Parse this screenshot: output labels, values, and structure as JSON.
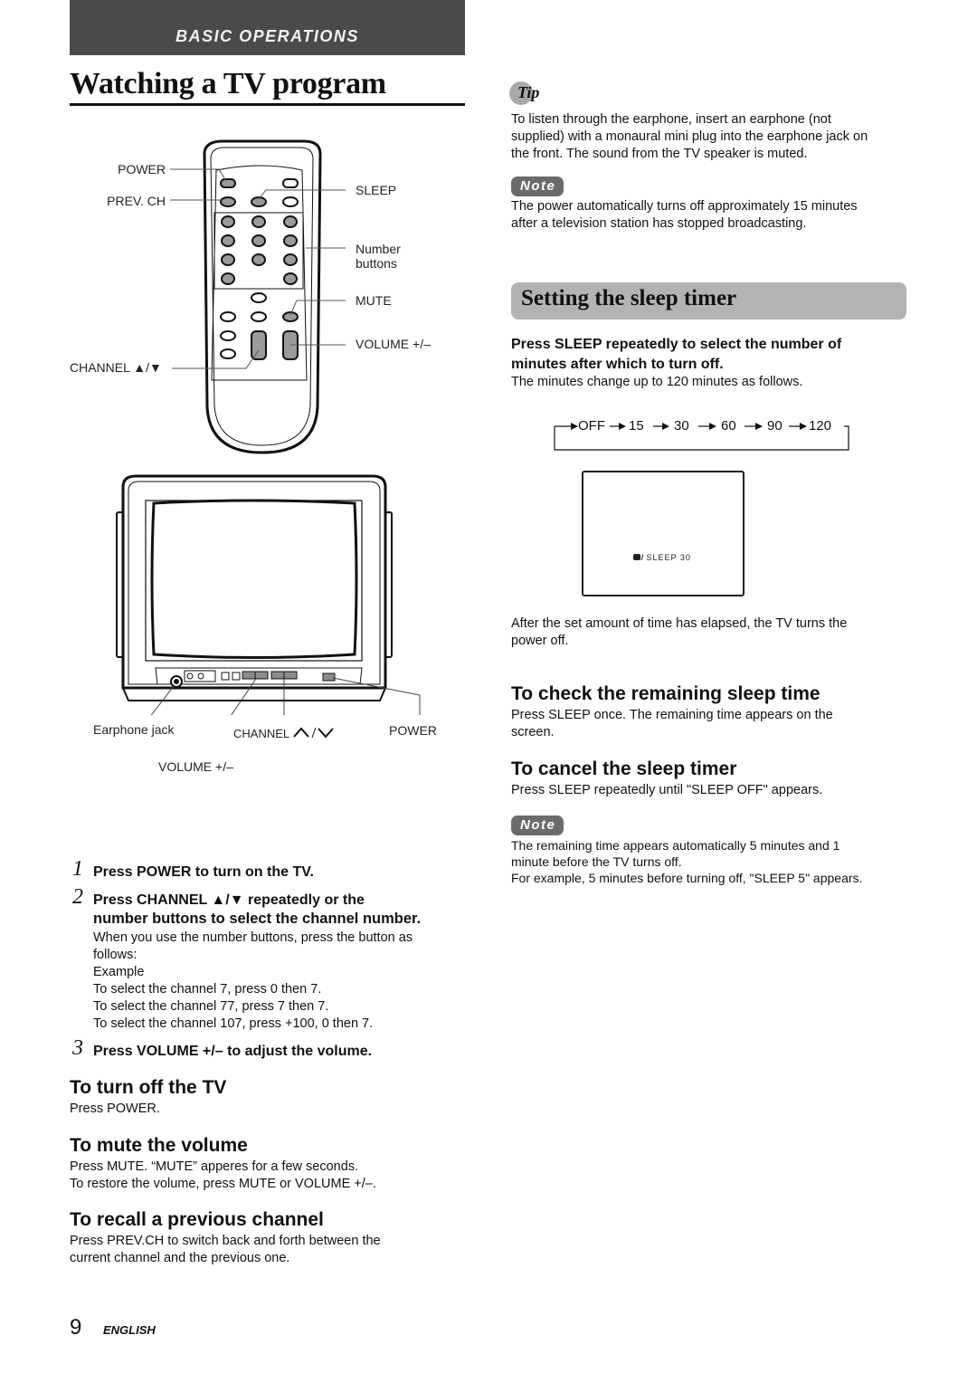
{
  "header": {
    "section": "BASIC OPERATIONS",
    "title": "Watching a TV program"
  },
  "remote_labels": {
    "power": "POWER",
    "prev_ch": "PREV. CH",
    "sleep": "SLEEP",
    "number_buttons_1": "Number",
    "number_buttons_2": "buttons",
    "mute": "MUTE",
    "volume": "VOLUME +/–",
    "channel": "CHANNEL ▲/▼"
  },
  "tv_labels": {
    "earphone": "Earphone jack",
    "channel": "CHANNEL",
    "power": "POWER",
    "volume": "VOLUME +/–"
  },
  "steps": [
    {
      "num": "1",
      "title": "Press POWER to turn on the TV."
    },
    {
      "num": "2",
      "title_1": "Press CHANNEL ▲/▼ repeatedly or the",
      "title_2": "number buttons to select the channel number.",
      "lines": [
        "When you use the number buttons, press the button as",
        "follows:",
        "Example",
        "To select the channel 7, press 0 then 7.",
        "To select the channel 77, press 7 then 7.",
        "To select the channel 107, press +100, 0 then 7."
      ]
    },
    {
      "num": "3",
      "title": "Press VOLUME +/– to adjust the volume."
    }
  ],
  "left_sections": [
    {
      "heading": "To turn off the TV",
      "lines": [
        "Press POWER."
      ]
    },
    {
      "heading": "To mute the volume",
      "lines": [
        "Press MUTE.  “MUTE” apperes for a few seconds.",
        "To restore the volume, press MUTE or VOLUME +/–."
      ]
    },
    {
      "heading": "To recall a previous channel",
      "lines": [
        "Press PREV.CH to switch back and forth between the",
        "current channel and the previous one."
      ]
    }
  ],
  "tip": {
    "label": "Tip",
    "lines": [
      "To listen through the earphone, insert an earphone (not",
      "supplied) with a monaural mini plug into the earphone jack on",
      "the front.  The sound from the TV speaker is muted."
    ]
  },
  "note1": {
    "label": "Note",
    "lines": [
      "The power automatically turns off approximately 15 minutes",
      "after a television station has stopped broadcasting."
    ]
  },
  "sleep": {
    "heading": "Setting the sleep timer",
    "instr_1": "Press SLEEP repeatedly to select the number of",
    "instr_2": "minutes after which to turn off.",
    "desc": "The minutes change up to 120 minutes as follows.",
    "sequence": [
      "OFF",
      "15",
      "30",
      "60",
      "90",
      "120"
    ],
    "osd": "SLEEP 30",
    "after_1": "After the set amount of time has elapsed, the TV turns the",
    "after_2": "power off."
  },
  "right_sections": [
    {
      "heading": "To check the remaining sleep time",
      "lines": [
        "Press SLEEP once.  The remaining time appears on the",
        "screen."
      ]
    },
    {
      "heading": "To cancel the sleep timer",
      "lines": [
        "Press SLEEP repeatedly until \"SLEEP OFF\" appears."
      ]
    }
  ],
  "note2": {
    "label": "Note",
    "lines": [
      "The remaining time appears automatically 5 minutes and 1",
      "minute before the TV turns off.",
      "For example, 5 minutes before turning off, \"SLEEP 5\" appears."
    ]
  },
  "footer": {
    "page": "9",
    "language": "ENGLISH"
  }
}
